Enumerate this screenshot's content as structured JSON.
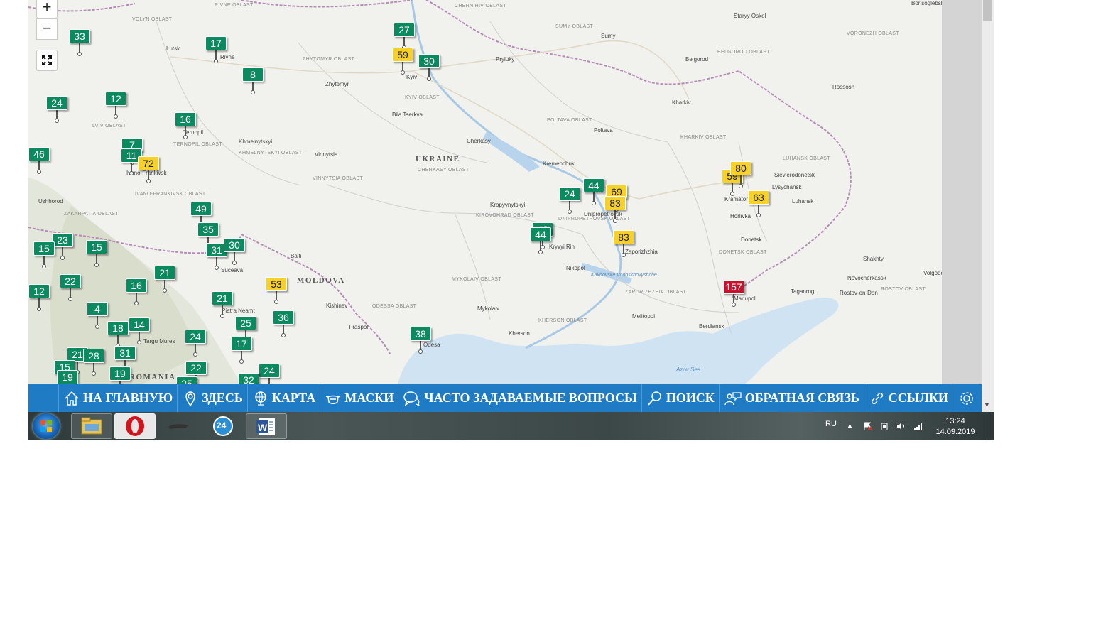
{
  "map": {
    "country_labels": [
      "UKRAINE",
      "MOLDOVA",
      "ROMANIA"
    ],
    "cities": [
      "Lutsk",
      "Rivne",
      "Zhytomyr",
      "Kyiv",
      "Bila Tserkva",
      "Pryluky",
      "Sumy",
      "Belgorod",
      "Kharkiv",
      "Poltava",
      "Cherkasy",
      "Kremenchuk",
      "Khmelnytskyi",
      "Vinnytsia",
      "Ternopil",
      "Uzhhorod",
      "Balti",
      "Kishinev",
      "Tiraspol",
      "Odesa",
      "Mykolaiv",
      "Kherson",
      "Kropyvnytskyi",
      "Kryvyi Rih",
      "Nikopol",
      "Melitopol",
      "Berdiansk",
      "Mariupol",
      "Donetsk",
      "Horlivka",
      "Kramatorsk",
      "Lysychansk",
      "Luhansk",
      "Sievierodonetsk",
      "Rossosh",
      "Staryy Oskol",
      "Borisoglebsk",
      "Shakhty",
      "Novocherkassk",
      "Rostov-on-Don",
      "Taganrog",
      "Volgodonsk",
      "Suceava",
      "Piatra Neamt",
      "Targu Mures",
      "Ivano-Frankivsk",
      "Dnipropetrovsk",
      "Zaporizhzhia"
    ],
    "oblasts": [
      "VOLYN OBLAST",
      "RIVNE OBLAST",
      "ZHYTOMYR OBLAST",
      "KYIV OBLAST",
      "CHERNIHIV OBLAST",
      "SUMY OBLAST",
      "BELGOROD OBLAST",
      "VORONEZH OBLAST",
      "POLTAVA OBLAST",
      "KHARKIV OBLAST",
      "CHERKASY OBLAST",
      "KHMELNYTSKYI OBLAST",
      "VINNYTSIA OBLAST",
      "TERNOPIL OBLAST",
      "LVIV OBLAST",
      "IVANO-FRANKIVSK OBLAST",
      "ZAKARPATIA OBLAST",
      "KIROVOHRAD OBLAST",
      "DNIPROPETROVSK OBLAST",
      "LUHANSK OBLAST",
      "DONETSK OBLAST",
      "ZAPORIZHZHIA OBLAST",
      "KHERSON OBLAST",
      "MYKOLAIV OBLAST",
      "ODESSA OBLAST",
      "ROSTOV OBLAST"
    ],
    "seas": [
      "Azov Sea"
    ],
    "kakhovka": "Kakhovske Vodoskhovyshche",
    "markers": [
      {
        "value": "27",
        "level": "good"
      },
      {
        "value": "59",
        "level": "moderate"
      },
      {
        "value": "30",
        "level": "good"
      },
      {
        "value": "33",
        "level": "good"
      },
      {
        "value": "17",
        "level": "good"
      },
      {
        "value": "8",
        "level": "good"
      },
      {
        "value": "24",
        "level": "good"
      },
      {
        "value": "12",
        "level": "good"
      },
      {
        "value": "16",
        "level": "good"
      },
      {
        "value": "46",
        "level": "good"
      },
      {
        "value": "7",
        "level": "good"
      },
      {
        "value": "11",
        "level": "good"
      },
      {
        "value": "72",
        "level": "moderate"
      },
      {
        "value": "49",
        "level": "good"
      },
      {
        "value": "35",
        "level": "good"
      },
      {
        "value": "31",
        "level": "good"
      },
      {
        "value": "30",
        "level": "good"
      },
      {
        "value": "23",
        "level": "good"
      },
      {
        "value": "15",
        "level": "good"
      },
      {
        "value": "15",
        "level": "good"
      },
      {
        "value": "21",
        "level": "good"
      },
      {
        "value": "22",
        "level": "good"
      },
      {
        "value": "16",
        "level": "good"
      },
      {
        "value": "12",
        "level": "good"
      },
      {
        "value": "53",
        "level": "moderate"
      },
      {
        "value": "21",
        "level": "good"
      },
      {
        "value": "36",
        "level": "good"
      },
      {
        "value": "4",
        "level": "good"
      },
      {
        "value": "18",
        "level": "good"
      },
      {
        "value": "14",
        "level": "good"
      },
      {
        "value": "25",
        "level": "good"
      },
      {
        "value": "24",
        "level": "good"
      },
      {
        "value": "17",
        "level": "good"
      },
      {
        "value": "31",
        "level": "good"
      },
      {
        "value": "21",
        "level": "good"
      },
      {
        "value": "28",
        "level": "good"
      },
      {
        "value": "15",
        "level": "good"
      },
      {
        "value": "19",
        "level": "good"
      },
      {
        "value": "19",
        "level": "good"
      },
      {
        "value": "22",
        "level": "good"
      },
      {
        "value": "24",
        "level": "good"
      },
      {
        "value": "32",
        "level": "good"
      },
      {
        "value": "25",
        "level": "good"
      },
      {
        "value": "38",
        "level": "good"
      },
      {
        "value": "24",
        "level": "good"
      },
      {
        "value": "44",
        "level": "good"
      },
      {
        "value": "69",
        "level": "moderate"
      },
      {
        "value": "83",
        "level": "moderate"
      },
      {
        "value": "43",
        "level": "good"
      },
      {
        "value": "44",
        "level": "good"
      },
      {
        "value": "83",
        "level": "moderate"
      },
      {
        "value": "59",
        "level": "moderate"
      },
      {
        "value": "80",
        "level": "moderate"
      },
      {
        "value": "63",
        "level": "moderate"
      },
      {
        "value": "157",
        "level": "unhealthy"
      }
    ],
    "zoom_in": "+",
    "zoom_out": "−"
  },
  "navbar": {
    "items": [
      {
        "label": "НА ГЛАВНУЮ",
        "icon": "home-icon"
      },
      {
        "label": "ЗДЕСЬ",
        "icon": "location-pin-icon"
      },
      {
        "label": "КАРТА",
        "icon": "globe-icon"
      },
      {
        "label": "МАСКИ",
        "icon": "mask-icon"
      },
      {
        "label": "ЧАСТО ЗАДАВАЕМЫЕ ВОПРОСЫ",
        "icon": "faq-icon"
      },
      {
        "label": "ПОИСК",
        "icon": "search-icon"
      },
      {
        "label": "ОБРАТНАЯ СВЯЗЬ",
        "icon": "feedback-icon"
      },
      {
        "label": "ССЫЛКИ",
        "icon": "link-icon"
      }
    ],
    "settings_icon": "gear-icon"
  },
  "taskbar": {
    "apps": [
      "start-button",
      "file-explorer",
      "opera",
      "game",
      "agent-24",
      "word"
    ],
    "agent_badge": "24",
    "language": "RU",
    "time": "13:24",
    "date": "14.09.2019"
  },
  "colors": {
    "good": "#0b8a5f",
    "moderate": "#f6d12a",
    "unhealthy": "#c8102e",
    "navbar": "#1e7bc4"
  }
}
